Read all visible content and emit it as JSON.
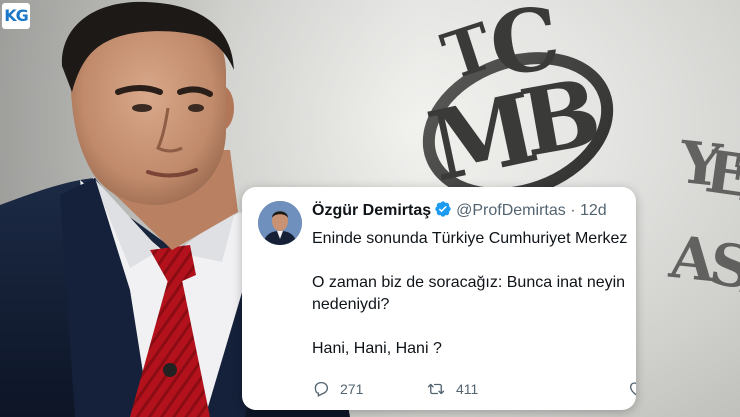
{
  "watermark": {
    "text": "KG"
  },
  "background": {
    "logo_letters": "TCMB",
    "wall_text_fragment": "YET ASI"
  },
  "tweet": {
    "display_name": "Özgür Demirtaş",
    "verified_icon": "verified-badge-icon",
    "handle": "@ProfDemirtas",
    "separator": "·",
    "time": "12d",
    "lines": [
      "Eninde sonunda Türkiye Cumhuriyet Merkez",
      "",
      "O zaman biz de soracağız: Bunca inat neyin",
      "nedeniydi?",
      "",
      "Hani, Hani, Hani ?"
    ],
    "actions": {
      "reply_icon": "reply-icon",
      "reply_count": "271",
      "retweet_icon": "retweet-icon",
      "retweet_count": "411",
      "like_icon": "heart-icon"
    }
  }
}
